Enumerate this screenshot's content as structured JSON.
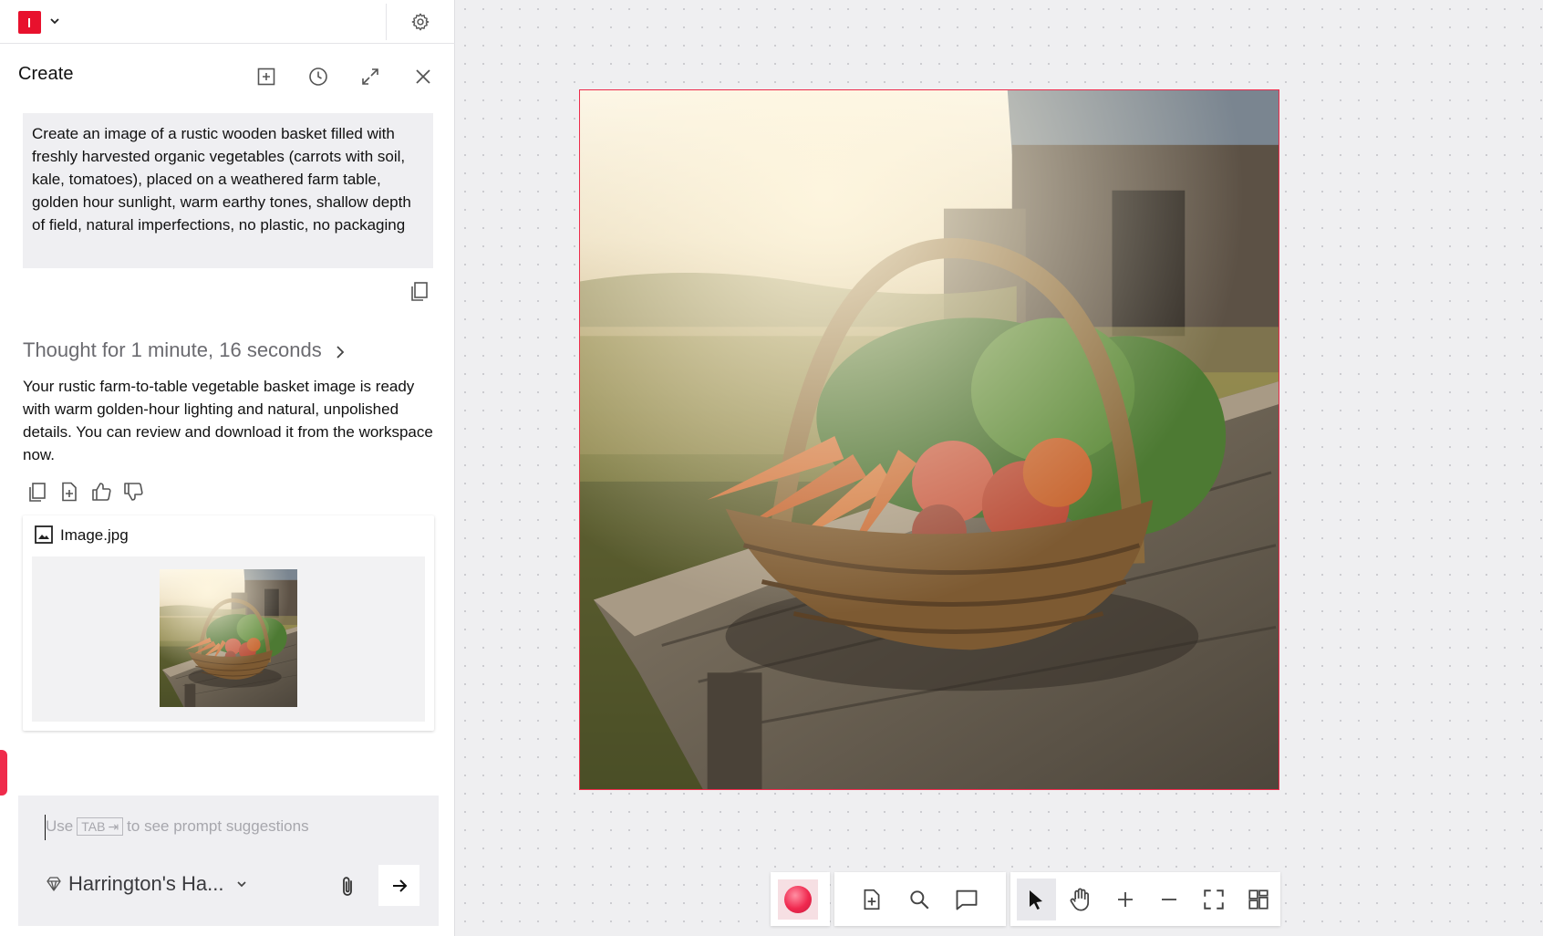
{
  "header": {
    "logo_icon": "adobe-express-logo",
    "brand_color": "#e8112d"
  },
  "create_panel": {
    "title": "Create",
    "prompt": "Create an image of a rustic wooden basket filled with freshly harvested organic vegetables (carrots with soil, kale, tomatoes), placed on a weathered farm table, golden hour sunlight, warm earthy tones, shallow depth of field, natural imperfections, no plastic, no packaging",
    "thought_label": "Thought for 1 minute, 16 seconds",
    "response": "Your rustic farm-to-table vegetable basket image is ready with warm golden-hour lighting and natural, unpolished details. You can review and download it from the workspace now.",
    "attachment": {
      "file_name": "Image.jpg"
    }
  },
  "composer": {
    "hint_prefix": "Use",
    "hint_key": "TAB",
    "hint_suffix": "to see prompt suggestions",
    "brand_kit": "Harrington's Ha..."
  },
  "toolbar": {
    "accent_color": "#f0294f"
  },
  "canvas": {
    "selection_color": "#ee2b4b"
  }
}
